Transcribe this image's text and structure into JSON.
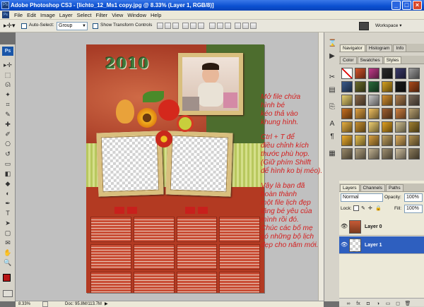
{
  "window": {
    "title": "Adobe Photoshop CS3 - [lichto_12_Ms1 copy.jpg @ 8.33% (Layer 1, RGB/8)]",
    "app_badge": "Ps",
    "minimize": "_",
    "maximize": "□",
    "close": "×"
  },
  "menu": [
    "File",
    "Edit",
    "Image",
    "Layer",
    "Select",
    "Filter",
    "View",
    "Window",
    "Help"
  ],
  "options": {
    "auto_select_label": "Auto-Select:",
    "auto_select_value": "Group",
    "show_transform_label": "Show Transform Controls",
    "workspace_label": "Workspace ▾"
  },
  "tools": {
    "badge": "Ps",
    "icons": [
      "move-tool",
      "marquee-tool",
      "lasso-tool",
      "magic-wand-tool",
      "crop-tool",
      "eyedropper-tool",
      "healing-brush-tool",
      "brush-tool",
      "clone-stamp-tool",
      "history-brush-tool",
      "eraser-tool",
      "gradient-tool",
      "blur-tool",
      "dodge-tool",
      "pen-tool",
      "type-tool",
      "path-selection-tool",
      "shape-tool",
      "notes-tool",
      "hand-tool",
      "zoom-tool"
    ],
    "glyphs": [
      "▸✛",
      "⬚",
      "ᘏ",
      "✦",
      "⌗",
      "✎",
      "✚",
      "✐",
      "⎔",
      "↺",
      "▭",
      "◧",
      "◆",
      "◐",
      "✒",
      "T",
      "➤",
      "▢",
      "✉",
      "✋",
      "🔍"
    ],
    "fg_color": "#b71515"
  },
  "document": {
    "zoom": "8.33%",
    "doc_size": "Doc: 95.8M/113.7M",
    "year": "2010"
  },
  "annotation": {
    "para1": [
      "Mở file chứa",
      "hình bé",
      "kéo thả vào",
      "khung hình."
    ],
    "para2": [
      "Ctrl + T để",
      "điều chỉnh kích",
      "thước phù hợp.",
      "(Giữ phím Shilft",
      "để hình ko bị méo)."
    ],
    "para3": [
      "Vậy là bạn đã",
      "hoàn thành",
      "một file lịch đẹp",
      "tặng bé yêu của",
      "mình rồi đó.",
      "Chúc các bố mẹ",
      "có những bộ lịch",
      "đẹp cho năm mới."
    ]
  },
  "panels": {
    "tabs_top": [
      "Navigator",
      "Histogram",
      "Info"
    ],
    "tabs_styles": [
      "Color",
      "Swatches",
      "Styles"
    ],
    "layers": {
      "tabs": [
        "Layers",
        "Channels",
        "Paths"
      ],
      "blend_mode": "Normal",
      "opacity_label": "Opacity:",
      "opacity_value": "100%",
      "lock_label": "Lock:",
      "fill_label": "Fill:",
      "fill_value": "100%",
      "items": [
        {
          "name": "Layer 0",
          "selected": false
        },
        {
          "name": "Layer 1",
          "selected": true
        }
      ]
    }
  },
  "styles_swatches": [
    "#ffffff",
    "#d4542a",
    "#c23a8a",
    "#2a2a2a",
    "#3a3a6a",
    "#9a9a9a",
    "#3a5a8a",
    "#6a6a2a",
    "#2a6a3a",
    "#d4a020",
    "#1a1a1a",
    "#aa4a1a",
    "#e8d070",
    "#8a6a4a",
    "#c8c8c8",
    "#d49030",
    "#b08050",
    "#7a6a5a",
    "#c87020",
    "#e0a040",
    "#f0c060",
    "#a06030",
    "#d08040",
    "#b8a070",
    "#e8b040",
    "#c89030",
    "#f0d070",
    "#e0a020",
    "#d0c090",
    "#a08030",
    "#f0b030",
    "#e8c050",
    "#d8a040",
    "#c0a060",
    "#e0b060",
    "#b09050",
    "#9a8a6a",
    "#b0a080",
    "#c0b090",
    "#a09070",
    "#d0c0a0",
    "#8a7a5a"
  ]
}
